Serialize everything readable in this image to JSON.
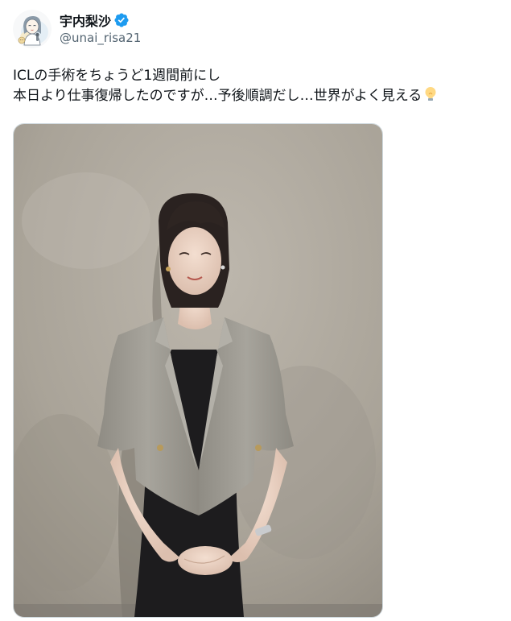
{
  "tweet": {
    "author": {
      "display_name": "宇内梨沙",
      "handle": "@unai_risa21",
      "verified": true,
      "avatar_icon": "illustrated-avatar-icon"
    },
    "text_lines": [
      "ICLの手術をちょうど1週間前にし",
      "本日より仕事復帰したのですが…予後順調だし…世界がよく見える"
    ],
    "emoji": "lightbulb-icon",
    "media": {
      "type": "photo",
      "description_icon": "photo-image"
    }
  },
  "colors": {
    "text": "#0f1419",
    "secondary": "#536471",
    "verified_badge": "#1d9bf0",
    "border": "#cfd9de"
  }
}
